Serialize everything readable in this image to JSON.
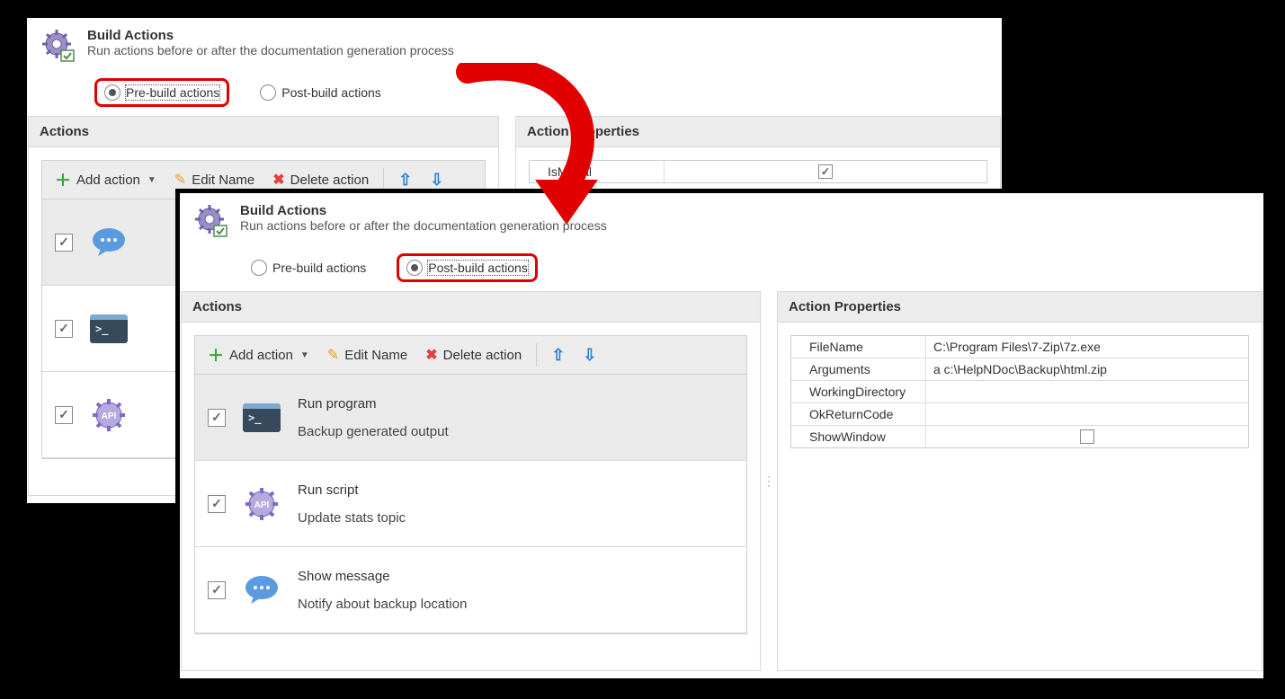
{
  "headerA": {
    "title": "Build Actions",
    "subtitle": "Run actions before or after the documentation generation process",
    "radios": {
      "pre": "Pre-build actions",
      "post": "Post-build actions"
    }
  },
  "headerB": {
    "title": "Build Actions",
    "subtitle": "Run actions before or after the documentation generation process",
    "radios": {
      "pre": "Pre-build actions",
      "post": "Post-build actions"
    }
  },
  "sectionTitles": {
    "actions": "Actions",
    "props": "Action Properties"
  },
  "toolbar": {
    "add": "Add action",
    "edit": "Edit Name",
    "del": "Delete action"
  },
  "panelA_props": [
    {
      "name": "IsModal",
      "type": "check",
      "checked": true
    }
  ],
  "panelB_actions": [
    {
      "title": "Run program",
      "sub": "Backup generated output",
      "icon": "terminal"
    },
    {
      "title": "Run script",
      "sub": "Update stats topic",
      "icon": "api"
    },
    {
      "title": "Show message",
      "sub": "Notify about backup location",
      "icon": "chat"
    }
  ],
  "panelB_props": [
    {
      "name": "FileName",
      "value": "C:\\Program Files\\7-Zip\\7z.exe"
    },
    {
      "name": "Arguments",
      "value": "a c:\\HelpNDoc\\Backup\\html.zip"
    },
    {
      "name": "WorkingDirectory",
      "value": ""
    },
    {
      "name": "OkReturnCode",
      "value": ""
    },
    {
      "name": "ShowWindow",
      "type": "check",
      "checked": false
    }
  ]
}
